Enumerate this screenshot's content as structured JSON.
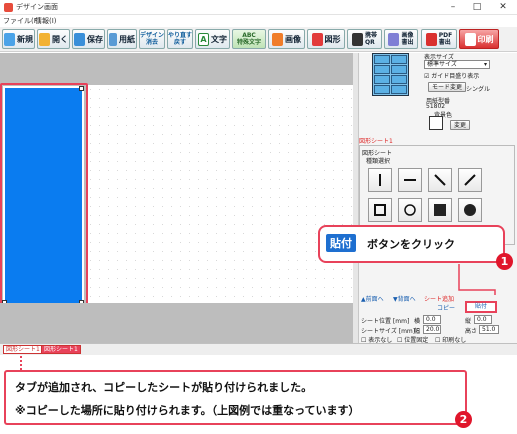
{
  "window": {
    "title": "デザイン画面",
    "minimize": "–",
    "maximize": "□",
    "close": "✕"
  },
  "menu": {
    "items": [
      "ファイル(F)",
      "情報(I)"
    ]
  },
  "toolbar": {
    "new": "新規",
    "open": "開く",
    "save": "保存",
    "paper": "用紙",
    "design_top": "デザイン",
    "design_bottom": "消去",
    "redo_top": "やり直す",
    "redo_bottom": "戻す",
    "text": "文字",
    "special_top": "ABC",
    "special_bottom": "特殊文字",
    "image": "画像",
    "shape": "図形",
    "qr_top": "携帯",
    "qr_bottom": "QR",
    "imgout_top": "画像",
    "imgout_bottom": "書出",
    "pdf_top": "PDF",
    "pdf_bottom": "書出",
    "print": "印刷"
  },
  "panel": {
    "display_size_label": "表示サイズ",
    "display_size_value": "標準サイズ",
    "guide_checkbox": "ガイド目盛り表示",
    "mode_button": "モード変更",
    "mode_value": "シングル",
    "paper_no_label": "用紙型番",
    "paper_no_value": "51802",
    "bg_color_label": "背景色",
    "change_button": "変更",
    "shape_sheet_title": "図形シート1",
    "shape_sheet_label": "図形シート",
    "type_select_label": "種類選択",
    "tab_front": "▲前面へ",
    "tab_back": "▼背面へ",
    "tab_sheet_add": "シート追加",
    "copy_button": "コピー",
    "paste_button": "貼付",
    "sheet_pos_label": "シート位置 [mm]",
    "horiz_label": "横",
    "horiz_value": "0.0",
    "vert_label": "縦",
    "vert_value": "0.0",
    "sheet_size_label": "シートサイズ [mm]",
    "width_label": "幅",
    "width_value": "20.0",
    "height_label": "高さ",
    "height_value": "51.0",
    "opt_hide": "表示なし",
    "opt_pos": "位置固定",
    "opt_print": "印刷なし"
  },
  "sheet_tabs": [
    "図形シート1",
    "図形シート1"
  ],
  "callout1": {
    "tag": "貼付",
    "text": "ボタンをクリック",
    "number": "1"
  },
  "callout2": {
    "line1": "タブが追加され、コピーしたシートが貼り付けられました。",
    "line2": "※コピーした場所に貼り付けられます。（上図例では重なっています）",
    "number": "2"
  },
  "colors": {
    "accent_red": "#e8425a",
    "sheet_blue": "#0a7cf0",
    "tag_blue": "#1e6fd0"
  }
}
